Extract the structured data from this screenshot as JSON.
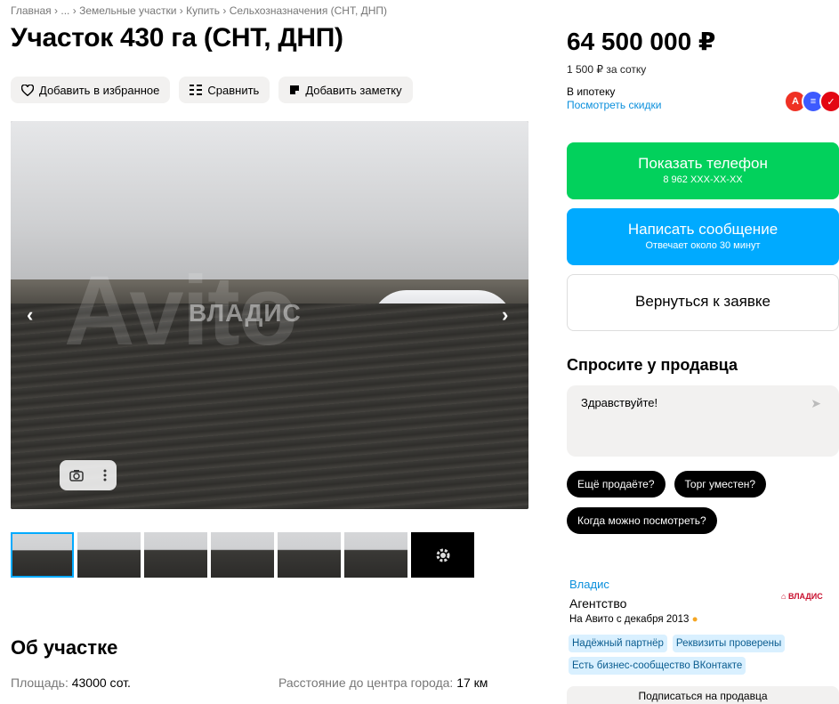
{
  "breadcrumbs": {
    "items": [
      "Главная",
      "...",
      "Земельные участки",
      "Купить",
      "Сельхозназначения (СНТ, ДНП)"
    ],
    "separator": "›"
  },
  "title": "Участок 430 га (СНТ, ДНП)",
  "actions": {
    "favorite": "Добавить в избранное",
    "compare": "Сравнить",
    "note": "Добавить заметку"
  },
  "gallery": {
    "watermark_agency": "ВЛАДИС",
    "watermark_brand": "Avito",
    "prev": "‹",
    "next": "›",
    "camera_icon": "camera-icon",
    "more_icon": "more-vertical-icon"
  },
  "thumbnails": [
    {
      "active": true
    },
    {
      "active": false
    },
    {
      "active": false
    },
    {
      "active": false
    },
    {
      "active": false
    },
    {
      "active": false
    },
    {
      "active": false,
      "icon": "settings-gear-icon"
    }
  ],
  "about": {
    "heading": "Об участке",
    "params": [
      {
        "label": "Площадь:",
        "value": "43000 сот."
      },
      {
        "label": "Расстояние до центра города:",
        "value": "17 км"
      }
    ]
  },
  "price": {
    "value": "64 500 000 ₽",
    "per_unit": "1 500 ₽ за сотку",
    "mortgage_label": "В ипотеку",
    "mortgage_link": "Посмотреть скидки",
    "banks": [
      {
        "letter": "А",
        "color": "#ef3124"
      },
      {
        "letter": "≡",
        "color": "#3d5afe"
      },
      {
        "letter": "✓",
        "color": "#e30613"
      }
    ]
  },
  "buttons": {
    "phone_label": "Показать телефон",
    "phone_number": "8 962 XXX-XX-XX",
    "message_label": "Написать сообщение",
    "message_sub": "Отвечает около 30 минут",
    "back_label": "Вернуться к заявке"
  },
  "ask": {
    "heading": "Спросите у продавца",
    "input_value": "Здравствуйте!",
    "chips": [
      "Ещё продаёте?",
      "Торг уместен?",
      "Когда можно посмотреть?"
    ]
  },
  "seller": {
    "name": "Владис",
    "type": "Агентство",
    "since": "На Авито с декабря 2013",
    "logo_text": "ВЛАДИС",
    "badges": [
      "Надёжный партнёр",
      "Реквизиты проверены",
      "Есть бизнес-сообщество ВКонтакте"
    ],
    "subscribe": "Подписаться на продавца"
  },
  "colors": {
    "green": "#02d15c",
    "blue": "#00aaff",
    "link": "#0a8fdc",
    "chip": "#000000",
    "badge_bg": "#d9f0ff"
  }
}
